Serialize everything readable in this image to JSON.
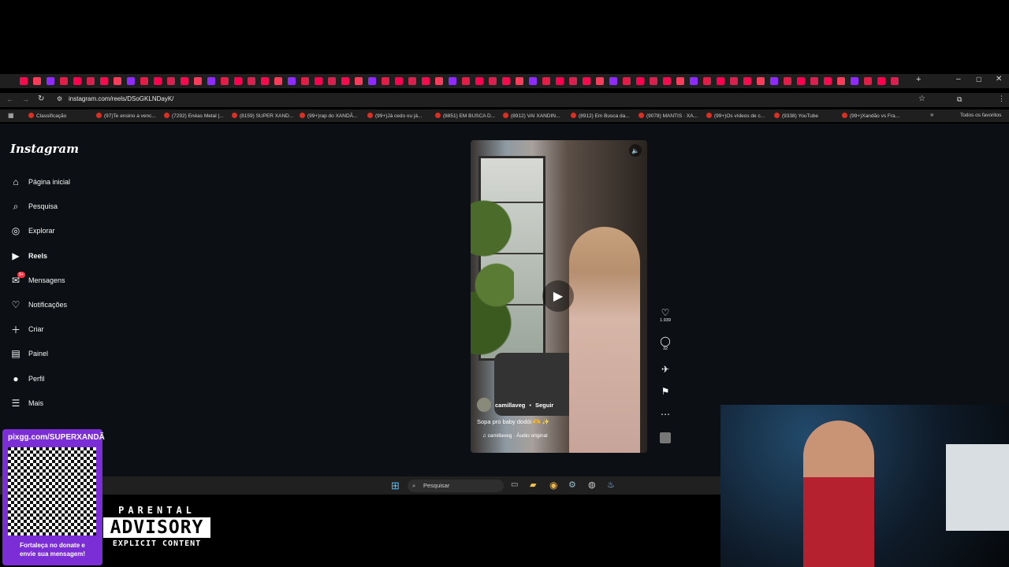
{
  "browser": {
    "url": "instagram.com/reels/DSoGKLNDayK/",
    "bookmarks": [
      "Classificação",
      "(97)Te ensino a venc...",
      "(7292) Enéas Metal |...",
      "(8159) SUPER XAND...",
      "(99+)rap do XANDÃ...",
      "(99+)Já cedo ou já...",
      "(8851) EM BUSCA D...",
      "(8912) VAI XANDIN...",
      "(8912) Em Busca da...",
      "(9078) MANTIS · XA...",
      "(99+)Os vídeos de c...",
      "(9338) YouTube",
      "(99+)Xandão vs Fra..."
    ],
    "all_bookmarks": "Todos os favoritos"
  },
  "instagram": {
    "logo": "Instagram",
    "nav": [
      {
        "label": "Página inicial",
        "icon": "home-icon"
      },
      {
        "label": "Pesquisa",
        "icon": "search-icon"
      },
      {
        "label": "Explorar",
        "icon": "compass-icon"
      },
      {
        "label": "Reels",
        "icon": "reels-icon"
      },
      {
        "label": "Mensagens",
        "icon": "messenger-icon",
        "badge": "9+"
      },
      {
        "label": "Notificações",
        "icon": "heart-icon"
      },
      {
        "label": "Criar",
        "icon": "plus-icon"
      },
      {
        "label": "Painel",
        "icon": "dashboard-icon"
      },
      {
        "label": "Perfil",
        "icon": "avatar-icon"
      },
      {
        "label": "Mais",
        "icon": "menu-icon"
      }
    ],
    "reel": {
      "username": "camillaveg",
      "follow": "Seguir",
      "caption": "Sopa pro baby dodói 🫶 ✨",
      "audio": "♫ camillaveg · Áudio original",
      "likes": "1.939",
      "comments": "32"
    }
  },
  "taskbar": {
    "search_placeholder": "Pesquisar"
  },
  "overlay": {
    "promo_url": "pixgg.com/SUPERXANDÃ",
    "promo_text_1": "Fortaleça no donate e",
    "promo_text_2": "envie sua mensagem!",
    "advisory_1": "PARENTAL",
    "advisory_2": "ADVISORY",
    "advisory_3": "EXPLICIT CONTENT"
  }
}
